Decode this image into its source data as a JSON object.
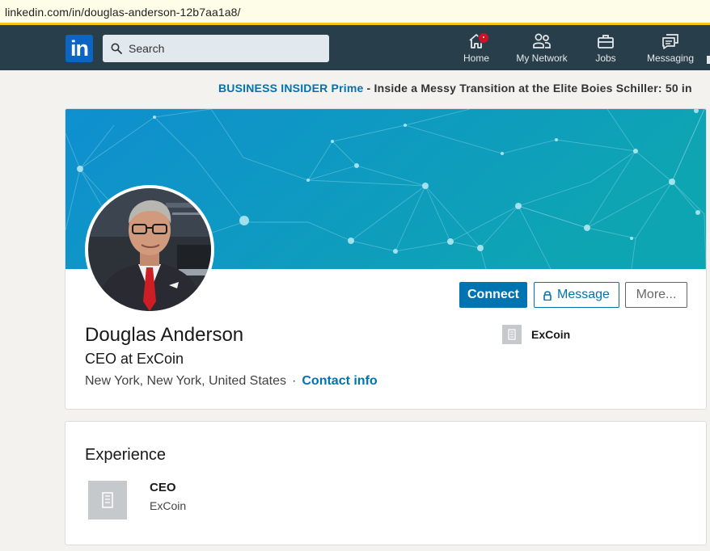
{
  "browser": {
    "url": "linkedin.com/in/douglas-anderson-12b7aa1a8/"
  },
  "nav": {
    "logo_text": "in",
    "search_placeholder": "Search",
    "items": [
      {
        "label": "Home",
        "icon": "home-icon",
        "notification": true
      },
      {
        "label": "My Network",
        "icon": "network-icon"
      },
      {
        "label": "Jobs",
        "icon": "briefcase-icon"
      },
      {
        "label": "Messaging",
        "icon": "messaging-icon"
      }
    ]
  },
  "ticker": {
    "source": "BUSINESS INSIDER Prime",
    "separator": " - ",
    "headline": "Inside a Messy Transition at the Elite Boies Schiller: 50 in"
  },
  "profile": {
    "name": "Douglas Anderson",
    "headline": "CEO at ExCoin",
    "location": "New York, New York, United States",
    "dot": "·",
    "contact_info": "Contact info",
    "buttons": {
      "connect": "Connect",
      "message": "Message",
      "more": "More..."
    },
    "current_company": "ExCoin"
  },
  "experience": {
    "title": "Experience",
    "items": [
      {
        "role": "CEO",
        "company": "ExCoin"
      }
    ]
  },
  "colors": {
    "brand": "#0a66c2",
    "nav_bg": "#283e4a",
    "action_blue": "#0073b1",
    "banner_start": "#0f8fd0",
    "banner_end": "#0ea1b3",
    "badge_red": "#d11124"
  }
}
